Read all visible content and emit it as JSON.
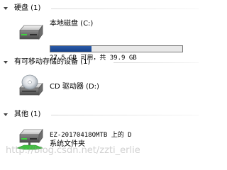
{
  "groups": [
    {
      "label": "硬盘 (1)"
    },
    {
      "label": "有可移动存储的设备 (1)"
    },
    {
      "label": "其他 (1)"
    }
  ],
  "local_disk": {
    "name": "本地磁盘 (C:)",
    "space": "27.5 GB 可用，共 39.9 GB",
    "used_fraction": 0.31,
    "bar_color": "#1f4e9a"
  },
  "cd_drive": {
    "name": "CD 驱动器 (D:)"
  },
  "network_drive": {
    "name": "EZ-20170418OMTB 上的 D",
    "sub": "系统文件夹"
  },
  "watermark": "http://blog.csdn.net/zzti_erlie"
}
